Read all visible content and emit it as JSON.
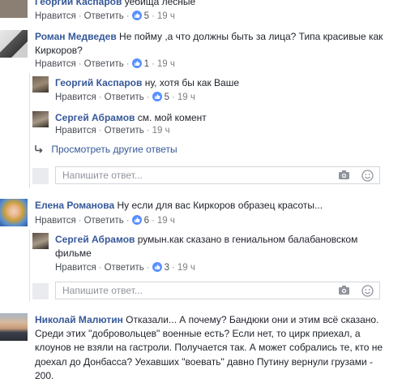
{
  "c0": {
    "author": "Георгий Каспаров",
    "text": "уебища лесные",
    "like": "Нравится",
    "reply": "Ответить",
    "likes": "5",
    "time": "19 ч"
  },
  "c1": {
    "author": "Роман Медведев",
    "text1": "Не пойму ,а что должны быть за лица? Типа красивые как",
    "text2": "Киркоров?",
    "like": "Нравится",
    "reply": "Ответить",
    "likes": "1",
    "time": "19 ч"
  },
  "r1a": {
    "author": "Георгий Каспаров",
    "text": "ну, хотя бы как Ваше",
    "like": "Нравится",
    "reply": "Ответить",
    "likes": "5",
    "time": "19 ч"
  },
  "r1b": {
    "author": "Сергей Абрамов",
    "text": "см. мой комент",
    "like": "Нравится",
    "reply": "Ответить",
    "time": "19 ч"
  },
  "more_replies": "Просмотреть другие ответы",
  "reply_placeholder": "Напишите ответ...",
  "c2": {
    "author": "Елена Романова",
    "text": "Ну если для вас Киркоров образец красоты...",
    "like": "Нравится",
    "reply": "Ответить",
    "likes": "6",
    "time": "19 ч"
  },
  "r2a": {
    "author": "Сергей Абрамов",
    "text1": "румын.как сказано в гениальном балабановском",
    "text2": "фильме",
    "like": "Нравится",
    "reply": "Ответить",
    "likes": "3",
    "time": "19 ч"
  },
  "c3": {
    "author": "Николай Малютин",
    "text1": "Отказали... А почему? Бандюки они и этим всё сказано.",
    "text2": "Среди этих \"добровольцев\" военные есть? Если нет, то цирк приехал, а",
    "text3": "клоунов не взяли на гастроли. Получается так. А может собрались те, кто не",
    "text4": "доехал до Донбасса? Уехавших \"воевать\" давно Путину вернули грузами -",
    "text5": "200."
  },
  "colors": {
    "link": "#365899",
    "like_badge": "#5890ff",
    "meta": "#90949c",
    "border": "#d3d6db"
  },
  "icons": [
    "thumbs-up-icon",
    "reply-arrow-icon",
    "camera-icon",
    "smiley-icon"
  ]
}
